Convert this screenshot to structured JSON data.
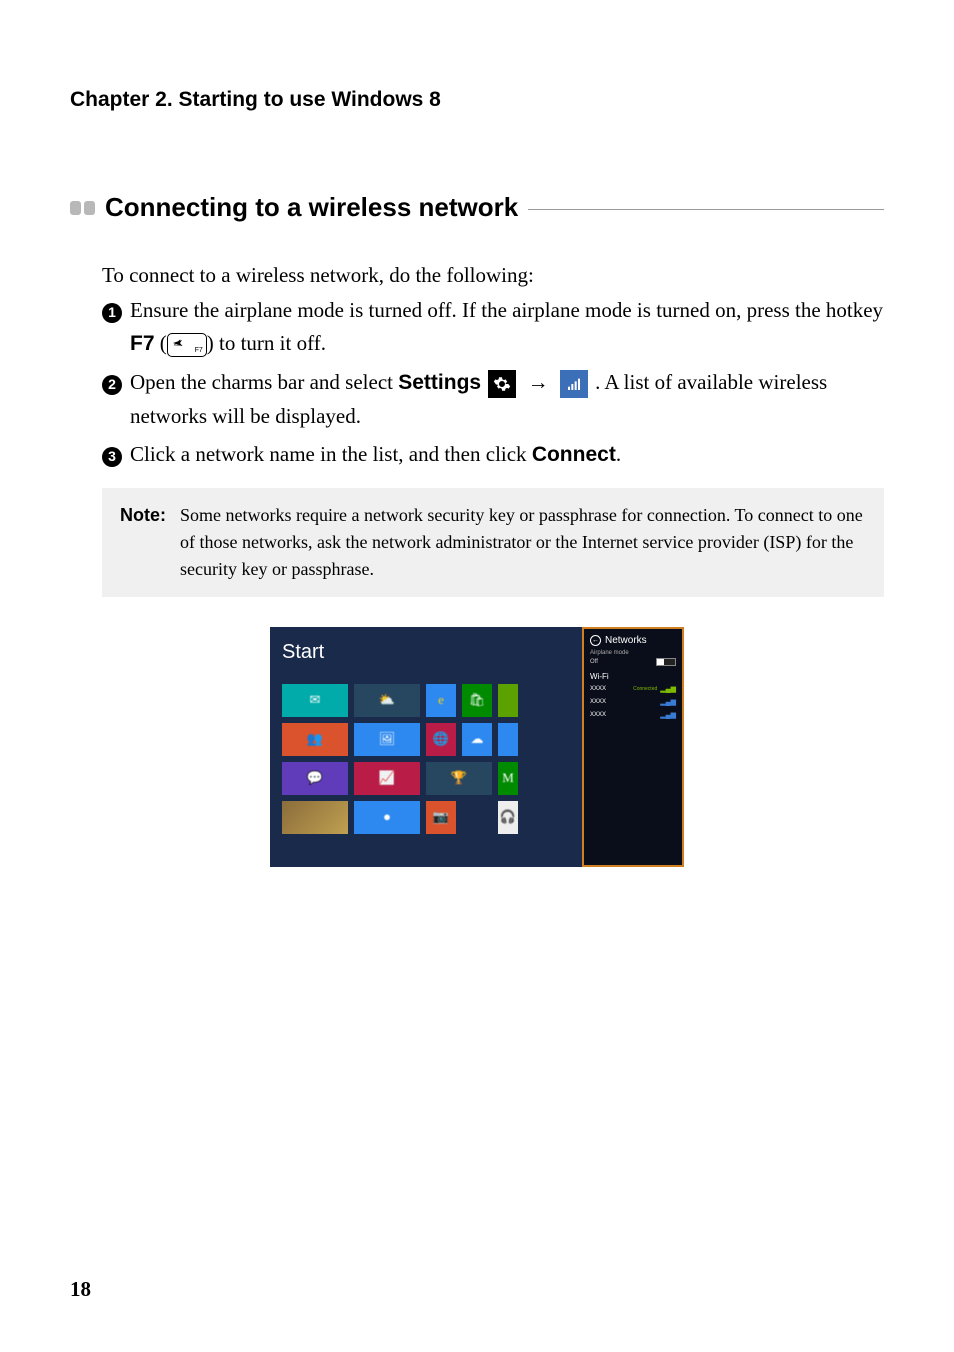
{
  "chapter": {
    "title": "Chapter 2. Starting to use Windows 8"
  },
  "section": {
    "title": "Connecting to a wireless network"
  },
  "intro": "To connect to a wireless network, do the following:",
  "steps": {
    "s1": {
      "pre": "Ensure the airplane mode is turned off. If the airplane mode is turned on, press the hotkey ",
      "key_label": "F7",
      "key_text": "F7",
      "post": ") to turn it off."
    },
    "s2": {
      "pre": "Open the charms bar and select ",
      "settings_label": "Settings",
      "arrow": "→",
      "post": ". A list of available wireless networks will be displayed."
    },
    "s3": {
      "pre": "Click a network name in the list, and then click ",
      "connect_label": "Connect",
      "post": "."
    }
  },
  "note": {
    "label": "Note:",
    "body": "Some networks require a network security key or passphrase for connection. To connect to one of those networks, ask the network administrator or the Internet service provider (ISP) for the security key or passphrase."
  },
  "screenshot": {
    "start_label": "Start",
    "networks": {
      "title": "Networks",
      "airplane_label": "Airplane mode",
      "off_label": "Off",
      "wifi_label": "Wi-Fi",
      "items": [
        {
          "name": "XXXX",
          "status": "Connected",
          "strong": true
        },
        {
          "name": "XXXX",
          "status": "",
          "strong": false
        },
        {
          "name": "XXXX",
          "status": "",
          "strong": false
        }
      ]
    }
  },
  "page_number": "18"
}
